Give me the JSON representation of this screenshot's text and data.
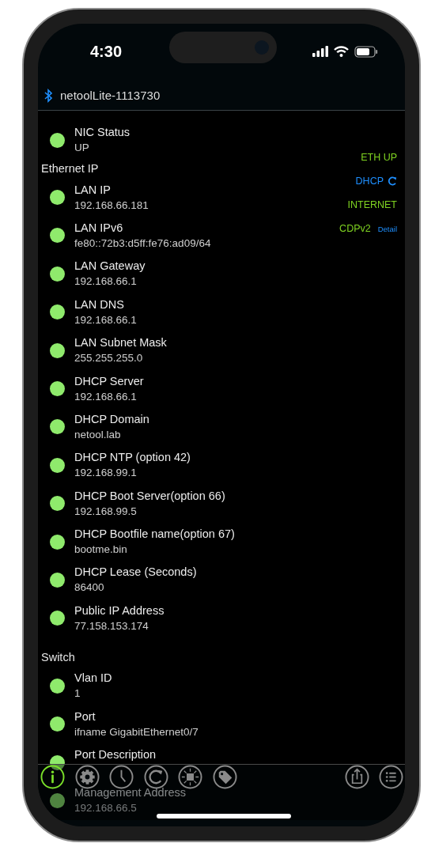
{
  "status_bar": {
    "time": "4:30"
  },
  "header": {
    "title": "netoolLite-1113730"
  },
  "sections": [
    {
      "items": [
        {
          "label": "NIC Status",
          "value": "UP"
        }
      ]
    },
    {
      "title": "Ethernet IP",
      "items": [
        {
          "label": "LAN IP",
          "value": "192.168.66.181"
        },
        {
          "label": "LAN IPv6",
          "value": "fe80::72b3:d5ff:fe76:ad09/64"
        },
        {
          "label": "LAN Gateway",
          "value": "192.168.66.1"
        },
        {
          "label": "LAN DNS",
          "value": "192.168.66.1"
        },
        {
          "label": "LAN Subnet Mask",
          "value": "255.255.255.0"
        },
        {
          "label": "DHCP Server",
          "value": "192.168.66.1"
        },
        {
          "label": "DHCP Domain",
          "value": "netool.lab"
        },
        {
          "label": "DHCP NTP (option 42)",
          "value": "192.168.99.1"
        },
        {
          "label": "DHCP Boot Server(option 66)",
          "value": "192.168.99.5"
        },
        {
          "label": "DHCP Bootfile name(option 67)",
          "value": "bootme.bin"
        },
        {
          "label": "DHCP Lease (Seconds)",
          "value": "86400"
        },
        {
          "label": "Public IP Address",
          "value": "77.158.153.174"
        }
      ]
    },
    {
      "title": "Switch",
      "items": [
        {
          "label": "Vlan ID",
          "value": "1"
        },
        {
          "label": "Port",
          "value": "ifname GigabitEthernet0/7"
        },
        {
          "label": "Port Description"
        },
        {
          "label": "Management Address",
          "value": "192.168.66.5"
        }
      ]
    }
  ],
  "status_flags": [
    {
      "kind": "plain",
      "label": "ETH UP",
      "color": "#7fd321"
    },
    {
      "kind": "refresh",
      "label": "DHCP",
      "color": "#1e8fff"
    },
    {
      "kind": "plain",
      "label": "INTERNET",
      "color": "#7fd321"
    },
    {
      "kind": "detail",
      "label": "CDPv2",
      "color": "#7fd321",
      "detail": "Detail"
    }
  ],
  "toolbar": [
    {
      "kind": "info",
      "selected": true
    },
    {
      "kind": "settings",
      "selected": false
    },
    {
      "kind": "history",
      "selected": false
    },
    {
      "kind": "refresh",
      "selected": false
    },
    {
      "kind": "light",
      "selected": false
    },
    {
      "kind": "tag",
      "selected": false
    },
    {
      "kind": "share",
      "selected": false
    },
    {
      "kind": "list",
      "selected": false
    }
  ]
}
